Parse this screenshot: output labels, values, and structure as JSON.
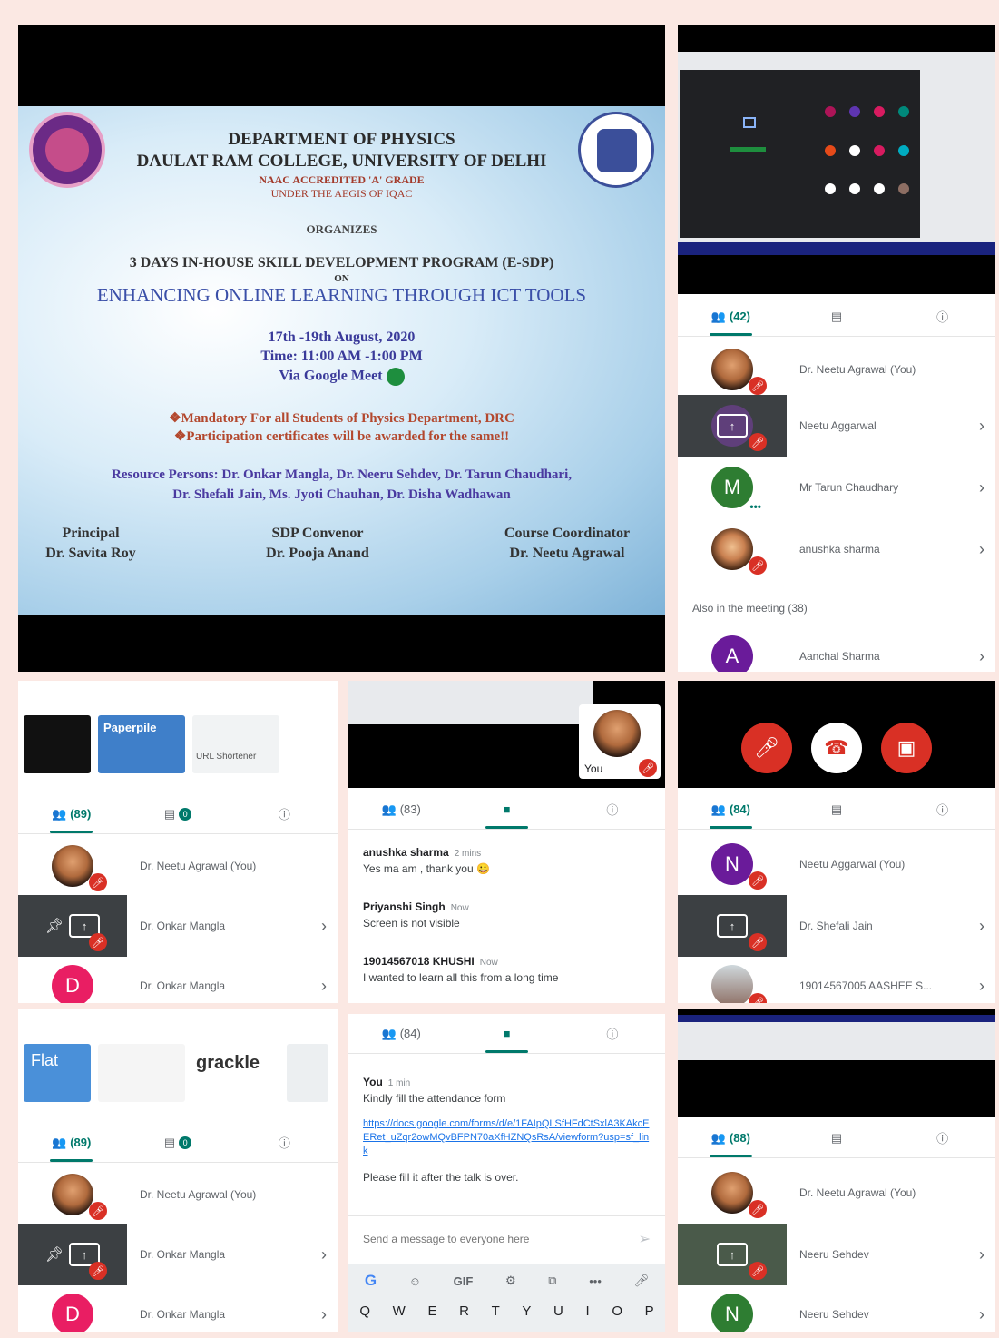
{
  "poster": {
    "dept": "DEPARTMENT OF PHYSICS",
    "college": "DAULAT RAM COLLEGE, UNIVERSITY OF DELHI",
    "naac": "NAAC ACCREDITED 'A' GRADE",
    "aegis": "UNDER THE AEGIS OF IQAC",
    "organizes": "ORGANIZES",
    "program": "3 DAYS IN-HOUSE SKILL DEVELOPMENT PROGRAM (E-SDP)",
    "on": "ON",
    "theme": "ENHANCING ONLINE LEARNING THROUGH ICT TOOLS",
    "dates": "17th -19th August, 2020",
    "time": "Time: 11:00 AM -1:00 PM",
    "via": "Via Google Meet",
    "mandatory": "❖Mandatory For all Students of Physics Department, DRC",
    "certificates": "❖Participation certificates will be awarded for the same!!",
    "resource1": "Resource Persons: Dr. Onkar Mangla, Dr. Neeru Sehdev, Dr. Tarun Chaudhari,",
    "resource2": "Dr. Shefali Jain, Ms. Jyoti Chauhan, Dr. Disha Wadhawan",
    "principal_role": "Principal",
    "principal_name": "Dr. Savita Roy",
    "convenor_role": "SDP Convenor",
    "convenor_name": "Dr. Pooja Anand",
    "coord_role": "Course Coordinator",
    "coord_name": "Dr. Neetu Agrawal"
  },
  "p1": {
    "count": "(42)",
    "rows": [
      "Dr. Neetu Agrawal (You)",
      "Neetu Aggarwal",
      "Mr Tarun Chaudhary",
      "anushka sharma"
    ],
    "m_initial": "M",
    "also": "Also in the meeting (38)",
    "extra": "Aanchal Sharma",
    "a_initial": "A"
  },
  "p2": {
    "count": "(89)",
    "badge": "0",
    "thumb2": "Paperpile",
    "thumb3": "URL Shortener",
    "rows": [
      "Dr. Neetu Agrawal (You)",
      "Dr. Onkar Mangla",
      "Dr. Onkar Mangla"
    ],
    "d_initial": "D"
  },
  "p3": {
    "count": "(83)",
    "you_label": "You",
    "messages": [
      {
        "name": "anushka sharma",
        "time": "2 mins",
        "text": "Yes ma am , thank you 😀"
      },
      {
        "name": "Priyanshi Singh",
        "time": "Now",
        "text": "Screen is not visible"
      },
      {
        "name": "19014567018 KHUSHI",
        "time": "Now",
        "text": "I wanted to learn all this from a long time"
      }
    ]
  },
  "p4": {
    "count": "(84)",
    "rows": [
      "Neetu Aggarwal (You)",
      "Dr. Shefali Jain",
      "19014567005 AASHEE S..."
    ],
    "n_initial": "N"
  },
  "p5": {
    "count": "(89)",
    "badge": "0",
    "thumb1": "Flat",
    "thumb3": "grackle",
    "rows": [
      "Dr. Neetu Agrawal (You)",
      "Dr. Onkar Mangla",
      "Dr. Onkar Mangla"
    ],
    "d_initial": "D"
  },
  "p6": {
    "count": "(84)",
    "you": "You",
    "you_time": "1 min",
    "msg1": "Kindly fill the attendance form",
    "link": "https://docs.google.com/forms/d/e/1FAIpQLSfHFdCtSxlA3KAkcEERet_uZqr2owMQvBFPN70aXfHZNQsRsA/viewform?usp=sf_link",
    "msg2": "Please fill it after the talk is over.",
    "placeholder": "Send a message to everyone here",
    "kbd_gif": "GIF",
    "kbd_keys": [
      "Q",
      "W",
      "E",
      "R",
      "T",
      "Y",
      "U",
      "I",
      "O",
      "P"
    ]
  },
  "p7": {
    "count": "(88)",
    "rows": [
      "Dr. Neetu Agrawal (You)",
      "Neeru Sehdev",
      "Neeru Sehdev"
    ],
    "n_initial": "N"
  },
  "colors": {
    "teal": "#00796b",
    "red": "#d93025",
    "purple": "#6a1b9a",
    "pink": "#e91e63",
    "green": "#2e7d32"
  }
}
